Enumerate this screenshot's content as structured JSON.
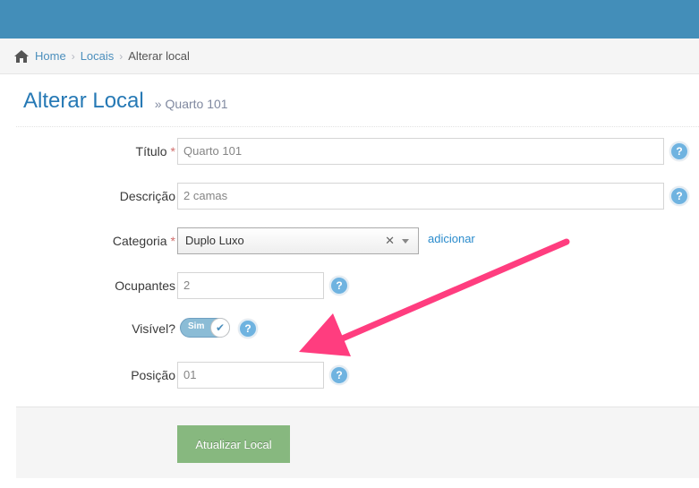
{
  "breadcrumb": {
    "home": "Home",
    "locais": "Locais",
    "current": "Alterar local"
  },
  "header": {
    "title": "Alterar Local",
    "subtitle": "Quarto 101"
  },
  "form": {
    "titulo": {
      "label": "Título",
      "value": "Quarto 101"
    },
    "descricao": {
      "label": "Descrição",
      "value": "2 camas"
    },
    "categoria": {
      "label": "Categoria",
      "value": "Duplo Luxo",
      "add_link": "adicionar"
    },
    "ocupantes": {
      "label": "Ocupantes",
      "value": "2"
    },
    "visivel": {
      "label": "Visível?",
      "toggle_text": "Sim",
      "checked": true
    },
    "posicao": {
      "label": "Posição",
      "value": "01"
    },
    "required_mark": "*",
    "help_glyph": "?"
  },
  "actions": {
    "submit_label": "Atualizar Local"
  },
  "colors": {
    "topbar": "#438eb9",
    "title": "#2679b5",
    "submit": "#87b87f",
    "annotation_arrow": "#ff3d7f"
  }
}
